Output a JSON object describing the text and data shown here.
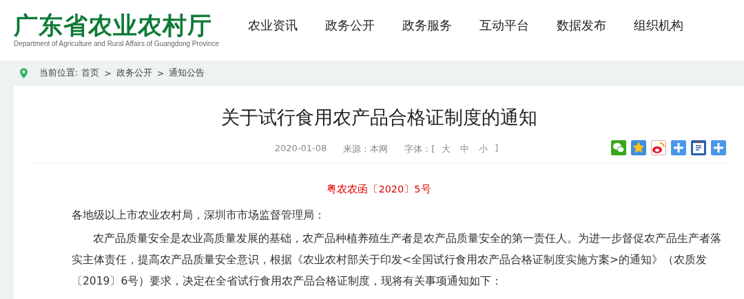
{
  "header": {
    "logo_title": "广东省农业农村厅",
    "logo_subtitle": "Department of Agriculture and Rural Affairs of Guangdong Province",
    "nav": [
      {
        "label": "农业资讯"
      },
      {
        "label": "政务公开"
      },
      {
        "label": "政务服务"
      },
      {
        "label": "互动平台"
      },
      {
        "label": "数据发布"
      },
      {
        "label": "组织机构"
      }
    ]
  },
  "breadcrumb": {
    "prefix": "当前位置:",
    "items": [
      "首页",
      "政务公开",
      "通知公告"
    ],
    "separator": ">"
  },
  "article": {
    "title": "关于试行食用农产品合格证制度的通知",
    "date": "2020-01-08",
    "source": "来源：本网",
    "font_label": "字体：[",
    "font_sizes": [
      "大",
      "中",
      "小"
    ],
    "font_close": "]",
    "share_icons": [
      {
        "kind": "wechat"
      },
      {
        "kind": "qzone"
      },
      {
        "kind": "weibo"
      },
      {
        "kind": "plus"
      },
      {
        "kind": "tieba"
      },
      {
        "kind": "plus"
      }
    ],
    "doc_number": "粤农农函〔2020〕5号",
    "salutation": "各地级以上市农业农村局，深圳市市场监督管理局：",
    "paragraphs": [
      "农产品质量安全是农业高质量发展的基础，农产品种植养殖生产者是农产品质量安全的第一责任人。为进一步督促农产品生产者落实主体责任，提高农产品质量安全意识，根据《农业农村部关于印发<全国试行食用农产品合格证制度实施方案>的通知》（农质发〔2019〕6号）要求，决定在全省试行食用农产品合格证制度，现将有关事项通知如下："
    ]
  }
}
